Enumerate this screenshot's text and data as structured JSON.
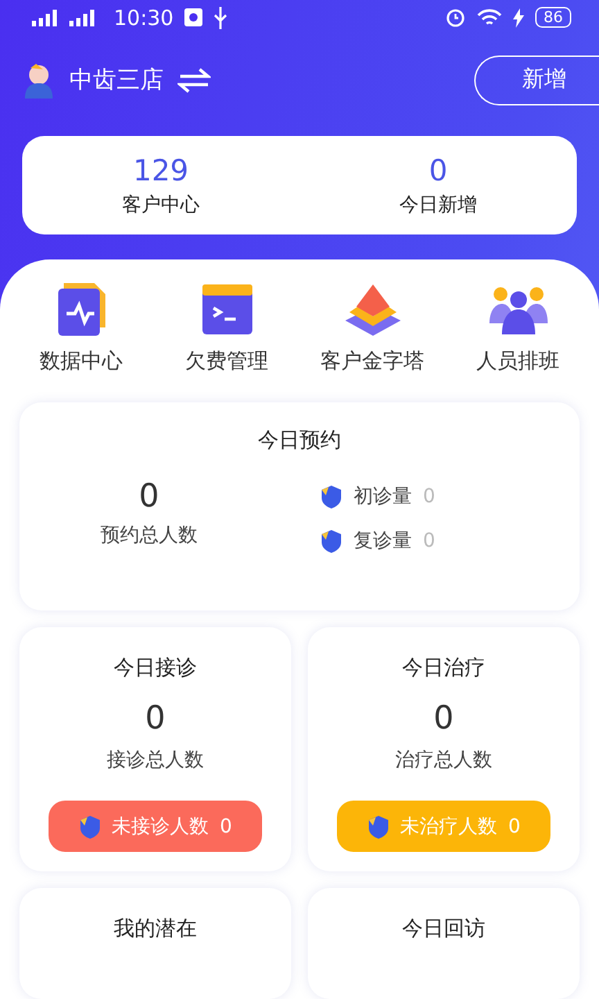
{
  "status_bar": {
    "time": "10:30",
    "battery": "86"
  },
  "header": {
    "store": "中齿三店",
    "add_button": "新增"
  },
  "summary": [
    {
      "value": "129",
      "label": "客户中心"
    },
    {
      "value": "0",
      "label": "今日新增"
    }
  ],
  "shortcuts": [
    {
      "kind": "data",
      "label": "数据中心"
    },
    {
      "kind": "terminal",
      "label": "欠费管理"
    },
    {
      "kind": "pyramid",
      "label": "客户金字塔"
    },
    {
      "kind": "people",
      "label": "人员排班"
    }
  ],
  "appointments": {
    "title": "今日预约",
    "value": "0",
    "label": "预约总人数",
    "breakdown": [
      {
        "label": "初诊量",
        "value": "0"
      },
      {
        "label": "复诊量",
        "value": "0"
      }
    ]
  },
  "cards": [
    {
      "title": "今日接诊",
      "value": "0",
      "label": "接诊总人数",
      "pill": "未接诊人数",
      "pill_value": "0",
      "color": "#fb6a5b"
    },
    {
      "title": "今日治疗",
      "value": "0",
      "label": "治疗总人数",
      "pill": "未治疗人数",
      "pill_value": "0",
      "color": "#fcb508"
    }
  ],
  "more_cards": [
    {
      "title": "我的潜在"
    },
    {
      "title": "今日回访"
    }
  ]
}
